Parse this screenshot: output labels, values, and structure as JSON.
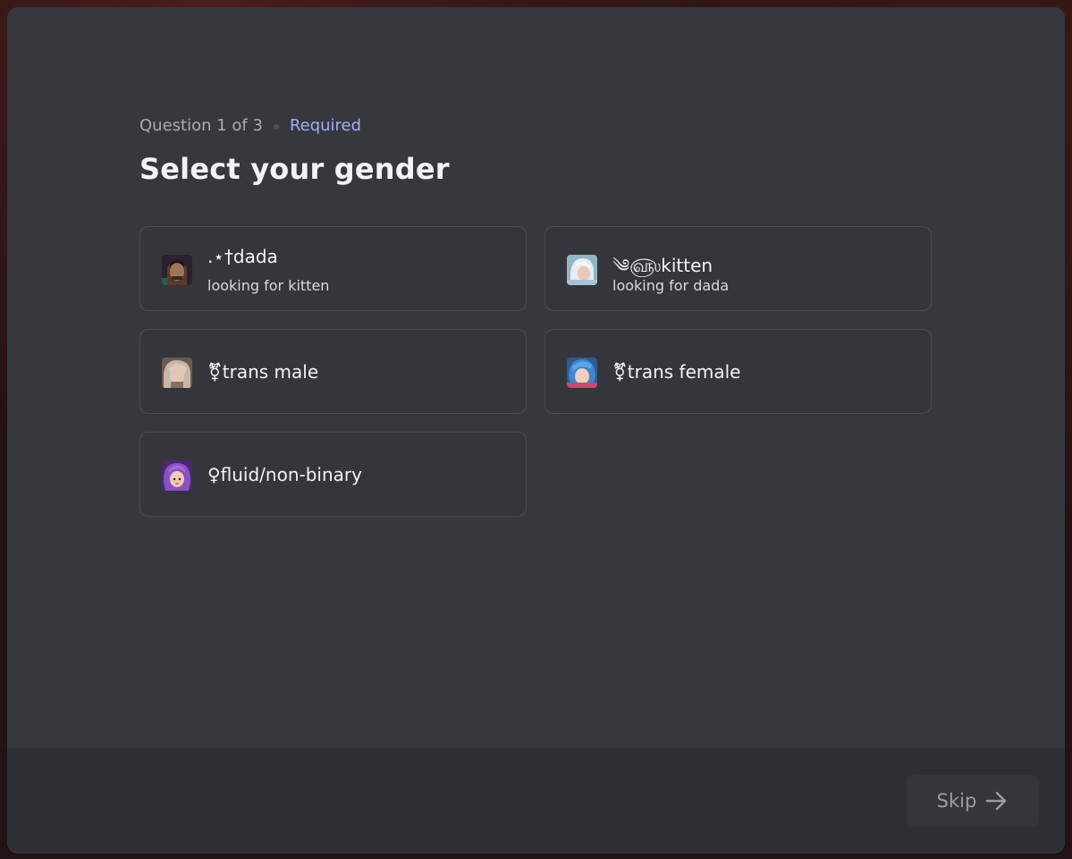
{
  "header": {
    "question_progress": "Question 1 of 3",
    "required_label": "Required",
    "title": "Select your gender"
  },
  "options": [
    {
      "label": ".⋆†dada",
      "sub": "looking for kitten",
      "avatar": "dark-haired-champion-avatar"
    },
    {
      "label": "༄௵kitten",
      "sub": "looking for dada",
      "avatar": "white-haired-champion-avatar"
    },
    {
      "label": "⚧trans male",
      "avatar": "pale-champion-avatar"
    },
    {
      "label": "⚧trans female",
      "avatar": "blue-haired-champion-avatar"
    },
    {
      "label": "♀fluid/non-binary",
      "avatar": "purple-haired-champion-avatar"
    }
  ],
  "footer": {
    "skip_label": "Skip",
    "skip_icon": "arrow-right-icon"
  },
  "colors": {
    "modal_bg": "#37383e",
    "footer_bg": "#2f3036",
    "accent": "#a3acf7",
    "text": "#f2f3f5",
    "muted": "#a9abb3"
  }
}
